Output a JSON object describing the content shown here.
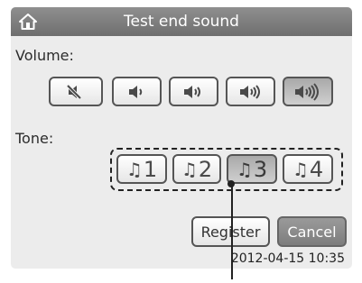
{
  "header": {
    "title": "Test end sound",
    "home_icon": "home-icon"
  },
  "volume": {
    "label": "Volume:",
    "levels": [
      {
        "icon": "speaker-muted-icon",
        "selected": false
      },
      {
        "icon": "speaker-level-1-icon",
        "selected": false
      },
      {
        "icon": "speaker-level-2-icon",
        "selected": false
      },
      {
        "icon": "speaker-level-3-icon",
        "selected": false
      },
      {
        "icon": "speaker-level-4-icon",
        "selected": true
      }
    ]
  },
  "tone": {
    "label": "Tone:",
    "options": [
      {
        "label": "1",
        "icon": "music-note-icon",
        "selected": false
      },
      {
        "label": "2",
        "icon": "music-note-icon",
        "selected": false
      },
      {
        "label": "3",
        "icon": "music-note-icon",
        "selected": true
      },
      {
        "label": "4",
        "icon": "music-note-icon",
        "selected": false
      }
    ]
  },
  "actions": {
    "register_label": "Register",
    "cancel_label": "Cancel"
  },
  "status": {
    "datetime": "2012-04-15 10:35"
  },
  "colors": {
    "titlebar": "#7a7a7a",
    "screen_bg": "#ececec",
    "selected_button": "#b5b5b5"
  }
}
